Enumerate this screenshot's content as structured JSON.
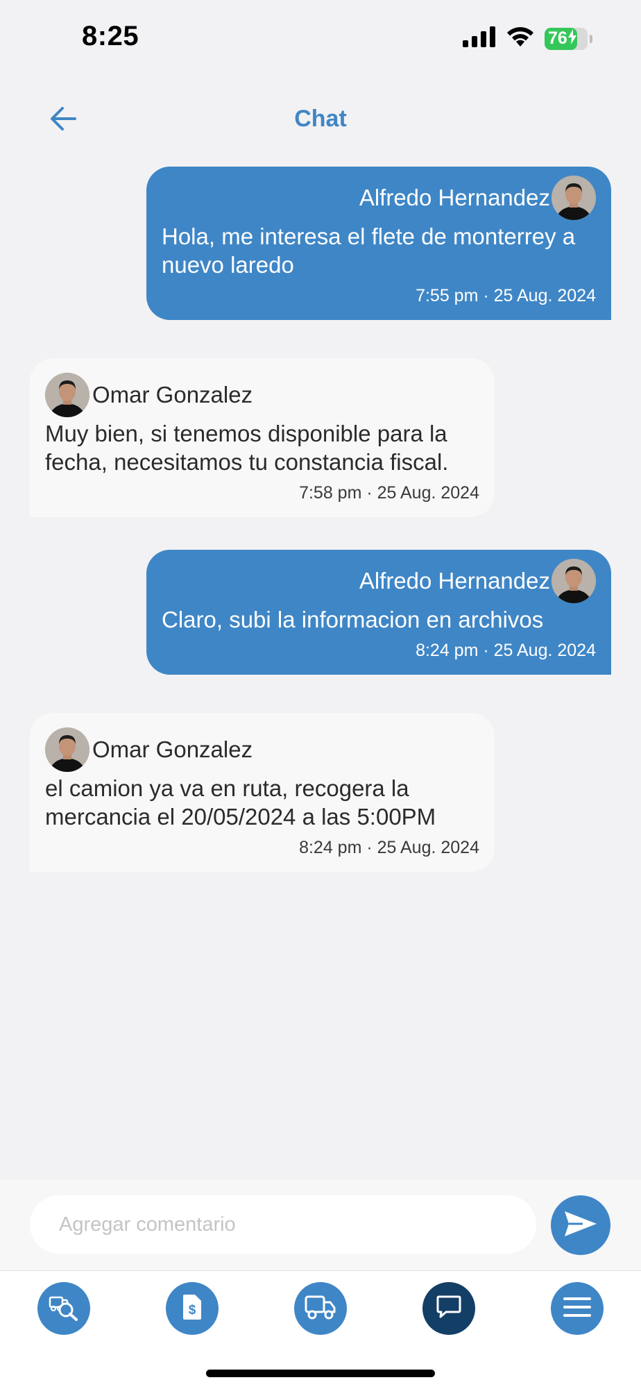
{
  "status_bar": {
    "time": "8:25",
    "battery_level": "76",
    "battery_percent": 76,
    "icons": [
      "cellular-signal-icon",
      "wifi-icon",
      "battery-charging-icon"
    ]
  },
  "header": {
    "title": "Chat",
    "back_icon": "arrow-left-icon"
  },
  "messages": [
    {
      "direction": "outgoing",
      "sender": "Alfredo Hernandez",
      "text": "Hola, me interesa el flete de monterrey a nuevo laredo",
      "time": "7:55 pm · 25 Aug. 2024"
    },
    {
      "direction": "incoming",
      "sender": "Omar Gonzalez",
      "text": "Muy bien, si tenemos disponible para la fecha, necesitamos tu constancia fiscal.",
      "time": "7:58 pm · 25 Aug. 2024"
    },
    {
      "direction": "outgoing",
      "sender": "Alfredo Hernandez",
      "text": "Claro, subi la informacion en archivos",
      "time": "8:24 pm · 25 Aug. 2024"
    },
    {
      "direction": "incoming",
      "sender": "Omar Gonzalez",
      "text": "el camion ya va en ruta, recogera la mercancia el 20/05/2024 a las 5:00PM",
      "time": "8:24 pm · 25 Aug. 2024"
    }
  ],
  "composer": {
    "placeholder": "Agregar comentario",
    "value": "",
    "send_icon": "send-icon"
  },
  "bottom_nav": {
    "items": [
      {
        "icon": "truck-search-icon",
        "active": false
      },
      {
        "icon": "invoice-icon",
        "active": false
      },
      {
        "icon": "truck-icon",
        "active": false
      },
      {
        "icon": "chat-bubble-icon",
        "active": true
      },
      {
        "icon": "menu-icon",
        "active": false
      }
    ]
  },
  "colors": {
    "accent": "#3f86c6",
    "nav_active": "#133e66",
    "background": "#f2f2f4",
    "incoming_bubble": "#f8f8f8",
    "battery_green": "#34c759"
  }
}
